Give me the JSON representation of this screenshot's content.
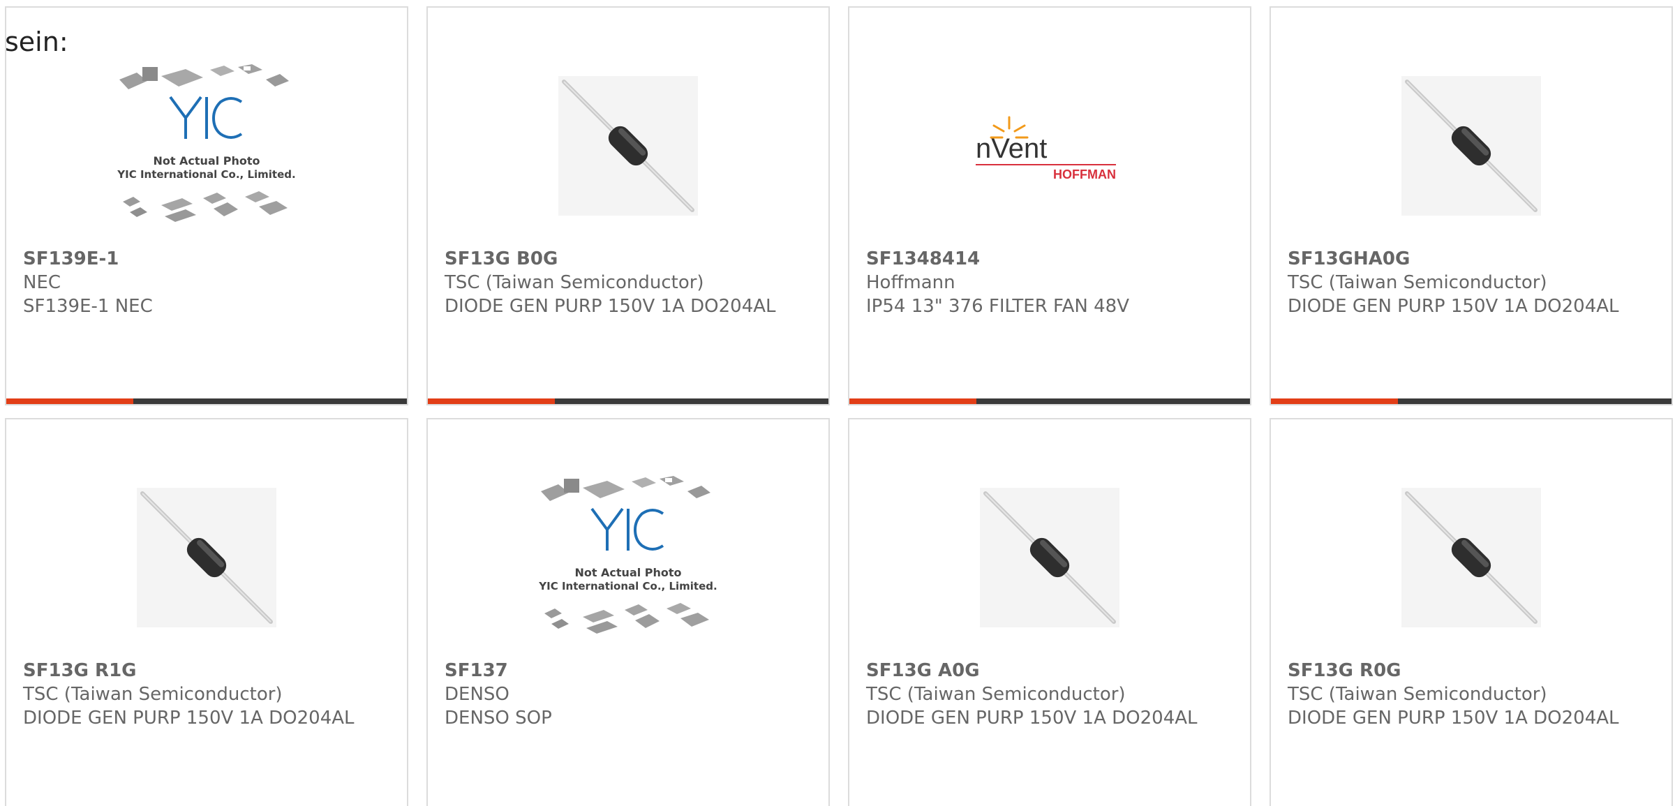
{
  "page_label": "sein:",
  "accent_color": "#e23e17",
  "bar_color": "#3a3a3a",
  "products": [
    {
      "part_no": "SF139E-1",
      "maker": "NEC",
      "desc": "SF139E-1 NEC",
      "image": "placeholder",
      "photo_note_1": "Not Actual Photo",
      "photo_note_2": "YIC International Co., Limited."
    },
    {
      "part_no": "SF13G B0G",
      "maker": "TSC (Taiwan Semiconductor)",
      "desc": "DIODE GEN PURP 150V 1A DO204AL",
      "image": "diode"
    },
    {
      "part_no": "SF1348414",
      "maker": "Hoffmann",
      "desc": "IP54 13\" 376 FILTER FAN 48V",
      "image": "nvent-logo",
      "logo_brand": "nVent",
      "logo_sub": "HOFFMAN"
    },
    {
      "part_no": "SF13GHA0G",
      "maker": "TSC (Taiwan Semiconductor)",
      "desc": "DIODE GEN PURP 150V 1A DO204AL",
      "image": "diode"
    },
    {
      "part_no": "SF13G R1G",
      "maker": "TSC (Taiwan Semiconductor)",
      "desc": "DIODE GEN PURP 150V 1A DO204AL",
      "image": "diode"
    },
    {
      "part_no": "SF137",
      "maker": "DENSO",
      "desc": "DENSO SOP",
      "image": "placeholder",
      "photo_note_1": "Not Actual Photo",
      "photo_note_2": "YIC International Co., Limited."
    },
    {
      "part_no": "SF13G A0G",
      "maker": "TSC (Taiwan Semiconductor)",
      "desc": "DIODE GEN PURP 150V 1A DO204AL",
      "image": "diode"
    },
    {
      "part_no": "SF13G R0G",
      "maker": "TSC (Taiwan Semiconductor)",
      "desc": "DIODE GEN PURP 150V 1A DO204AL",
      "image": "diode"
    }
  ]
}
